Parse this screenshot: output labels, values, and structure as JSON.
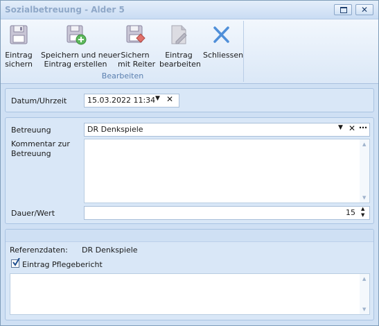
{
  "window": {
    "title": "Sozialbetreuung - Alder 5"
  },
  "ribbon": {
    "group_label": "Bearbeiten",
    "buttons": [
      {
        "line1": "Eintrag",
        "line2": "sichern",
        "icon": "floppy-disk-icon"
      },
      {
        "line1": "Speichern und neuer",
        "line2": "Eintrag erstellen",
        "icon": "save-new-icon"
      },
      {
        "line1": "Sichern",
        "line2": "mit Reiter",
        "icon": "save-tab-icon"
      },
      {
        "line1": "Eintrag",
        "line2": "bearbeiten",
        "icon": "edit-document-icon"
      },
      {
        "line1": "Schliessen",
        "line2": "",
        "icon": "close-x-icon"
      }
    ]
  },
  "datum": {
    "label": "Datum/Uhrzeit",
    "value": "15.03.2022 11:34"
  },
  "betreuung": {
    "label": "Betreuung",
    "value": "DR Denkspiele",
    "comment_label": "Kommentar zur Betreuung",
    "comment": "",
    "dauer_label": "Dauer/Wert",
    "dauer_value": "15"
  },
  "referenz": {
    "label": "Referenzdaten:",
    "value": "DR Denkspiele",
    "checkbox_label": "Eintrag Pflegebericht",
    "checked": true,
    "notes": ""
  }
}
